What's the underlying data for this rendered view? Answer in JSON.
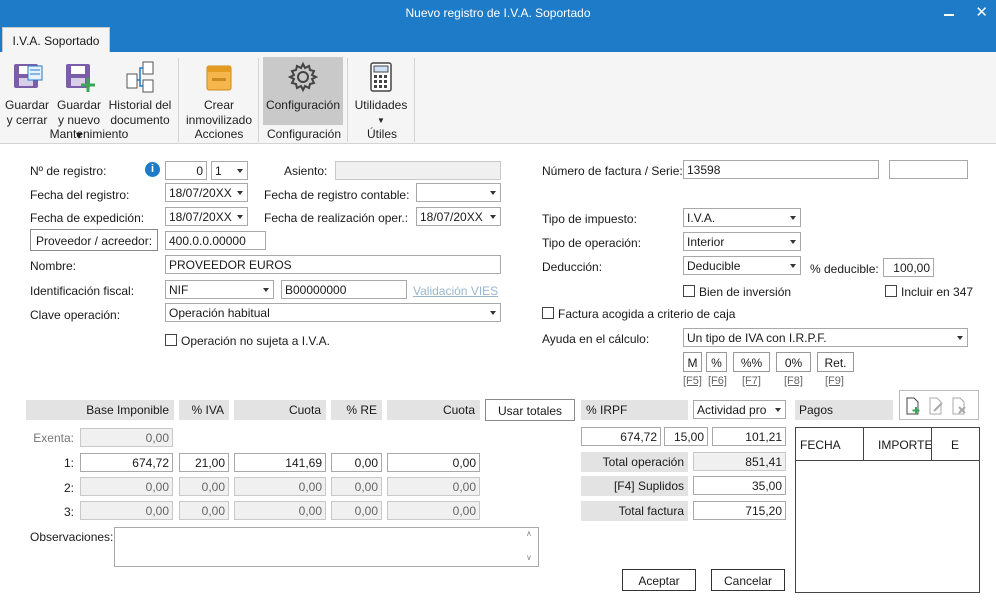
{
  "window": {
    "title": "Nuevo registro de I.V.A. Soportado"
  },
  "tab": {
    "label": "I.V.A. Soportado"
  },
  "ribbon": {
    "guardar_cerrar": [
      "Guardar",
      "y cerrar"
    ],
    "guardar_nuevo": [
      "Guardar",
      "y nuevo ▾"
    ],
    "historial": [
      "Historial del",
      "documento"
    ],
    "crear": [
      "Crear",
      "inmovilizado"
    ],
    "configuracion": "Configuración",
    "utilidades": "Utilidades",
    "groups": {
      "mantenimiento": "Mantenimiento",
      "acciones": "Acciones",
      "configuracion": "Configuración",
      "utiles": "Útiles"
    }
  },
  "form": {
    "num_registro_label": "Nº de registro:",
    "num_registro_value": "0",
    "num_registro_series": "1",
    "asiento_label": "Asiento:",
    "asiento_value": "",
    "fecha_registro_label": "Fecha del registro:",
    "fecha_registro_value": "18/07/20XX",
    "fecha_contable_label": "Fecha de registro contable:",
    "fecha_contable_value": "",
    "fecha_expedicion_label": "Fecha de expedición:",
    "fecha_expedicion_value": "18/07/20XX",
    "fecha_realizacion_label": "Fecha de realización oper.:",
    "fecha_realizacion_value": "18/07/20XX",
    "proveedor_button": "Proveedor / acreedor:",
    "proveedor_value": "400.0.0.00000",
    "nombre_label": "Nombre:",
    "nombre_value": "PROVEEDOR EUROS",
    "ident_label": "Identificación fiscal:",
    "ident_type": "NIF",
    "ident_value": "B00000000",
    "validacion_vies": "Validación VIES",
    "clave_label": "Clave operación:",
    "clave_value": "Operación habitual",
    "no_sujeta_label": "Operación no sujeta a I.V.A."
  },
  "right": {
    "num_factura_label": "Número de factura / Serie:",
    "num_factura_value": "13598",
    "serie_value": "",
    "tipo_impuesto_label": "Tipo de impuesto:",
    "tipo_impuesto_value": "I.V.A.",
    "tipo_operacion_label": "Tipo de operación:",
    "tipo_operacion_value": "Interior",
    "deduccion_label": "Deducción:",
    "deduccion_value": "Deducible",
    "pct_deducible_label": "% deducible:",
    "pct_deducible_value": "100,00",
    "bien_inversion_label": "Bien de inversión",
    "incluir_347_label": "Incluir en 347",
    "criterio_caja_label": "Factura acogida a criterio de caja",
    "ayuda_label": "Ayuda en el cálculo:",
    "ayuda_value": "Un tipo de IVA con I.R.P.F.",
    "calc_buttons": [
      {
        "label": "M",
        "key": "[F5]"
      },
      {
        "label": "%",
        "key": "[F6]"
      },
      {
        "label": "%%",
        "key": "[F7]"
      },
      {
        "label": "0%",
        "key": "[F8]"
      },
      {
        "label": "Ret.",
        "key": "[F9]"
      }
    ]
  },
  "grid": {
    "headers": {
      "base": "Base Imponible",
      "iva": "% IVA",
      "cuota": "Cuota",
      "re": "% RE",
      "cuota_re": "Cuota",
      "usar_totales": "Usar totales",
      "irpf": "% IRPF",
      "actividad": "Actividad pro",
      "pagos": "Pagos"
    },
    "exenta_label": "Exenta:",
    "exenta_value": "0,00",
    "rows": [
      {
        "label": "1:",
        "base": "674,72",
        "iva": "21,00",
        "cuota": "141,69",
        "re": "0,00",
        "cuota_re": "0,00"
      },
      {
        "label": "2:",
        "base": "0,00",
        "iva": "0,00",
        "cuota": "0,00",
        "re": "0,00",
        "cuota_re": "0,00"
      },
      {
        "label": "3:",
        "base": "0,00",
        "iva": "0,00",
        "cuota": "0,00",
        "re": "0,00",
        "cuota_re": "0,00"
      }
    ],
    "irpf_base": "674,72",
    "irpf_pct": "15,00",
    "irpf_cuota": "101,21",
    "total_operacion_label": "Total operación",
    "total_operacion_value": "851,41",
    "suplidos_label": "[F4] Suplidos",
    "suplidos_value": "35,00",
    "total_factura_label": "Total factura",
    "total_factura_value": "715,20"
  },
  "pagos": {
    "col_fecha": "FECHA",
    "col_importe": "IMPORTE",
    "col_e": "E"
  },
  "observaciones_label": "Observaciones:",
  "observaciones_value": "",
  "aceptar": "Aceptar",
  "cancelar": "Cancelar"
}
